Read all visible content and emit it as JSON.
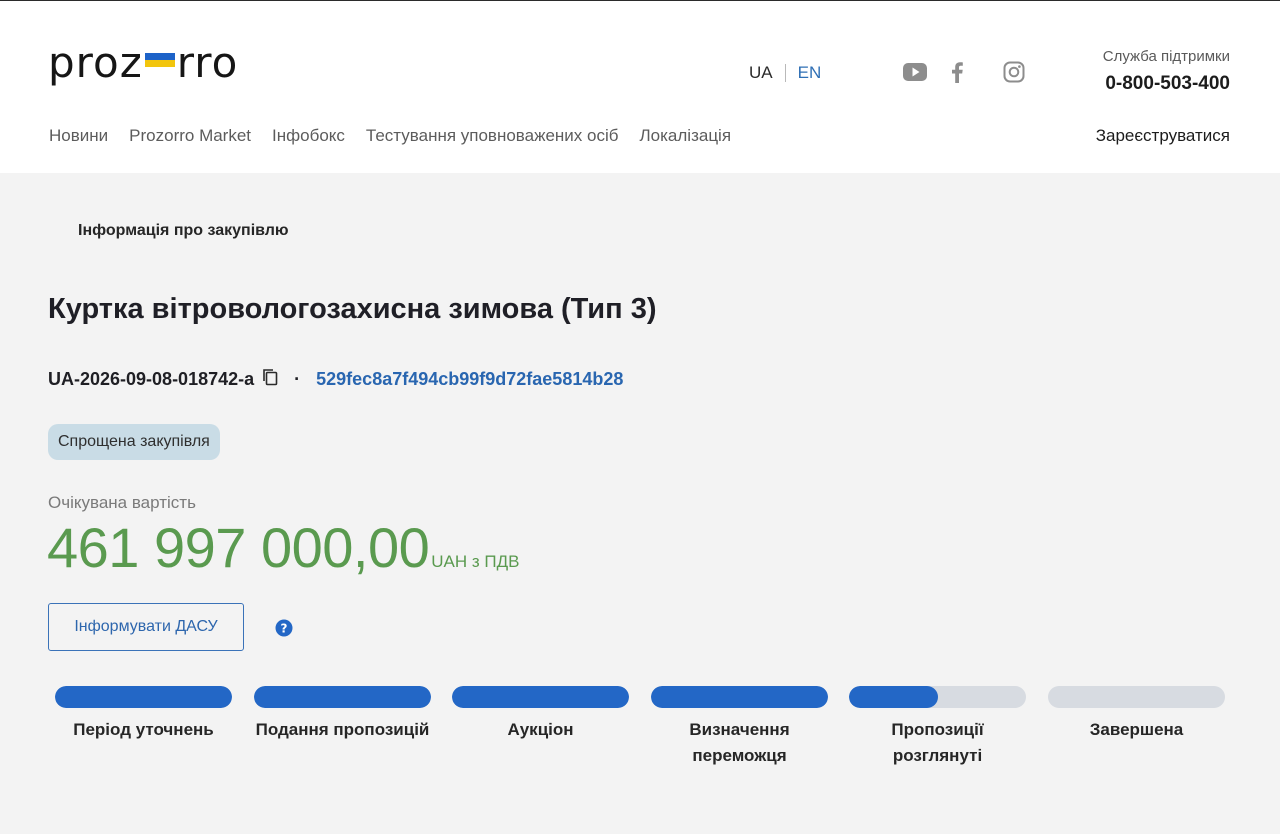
{
  "header": {
    "logo_left": "proz",
    "logo_right": "rro",
    "lang_ua": "UA",
    "lang_en": "EN",
    "support_label": "Служба підтримки",
    "support_phone": "0-800-503-400",
    "nav": [
      "Новини",
      "Prozorro Market",
      "Інфобокс",
      "Тестування уповноважених осіб",
      "Локалізація"
    ],
    "register": "Зареєструватися",
    "social_icons": [
      "youtube-icon",
      "facebook-icon",
      "instagram-icon"
    ]
  },
  "breadcrumb": "Інформація про закупівлю",
  "tender": {
    "title": "Куртка вітровологозахисна зимова (Тип 3)",
    "id": "UA-2026-09-08-018742-a",
    "separator": "·",
    "hash": "529fec8a7f494cb99f9d72fae5814b28",
    "type_badge": "Спрощена закупівля",
    "expected_label": "Очікувана вартість",
    "amount": "461 997 000,00",
    "currency": "UAH з ПДВ",
    "inform_button": "Інформувати ДАСУ"
  },
  "colors": {
    "accent": "#2367c6",
    "amount": "#5a9a4f",
    "badge": "#c9dce6",
    "link": "#2966b0"
  },
  "stages": [
    {
      "label": "Період уточнень",
      "progress": 1.0
    },
    {
      "label": "Подання пропозицій",
      "progress": 1.0
    },
    {
      "label": "Аукціон",
      "progress": 1.0
    },
    {
      "label": "Визначення переможця",
      "progress": 1.0
    },
    {
      "label": "Пропозиції розглянуті",
      "progress": 0.5
    },
    {
      "label": "Завершена",
      "progress": 0.0
    }
  ]
}
